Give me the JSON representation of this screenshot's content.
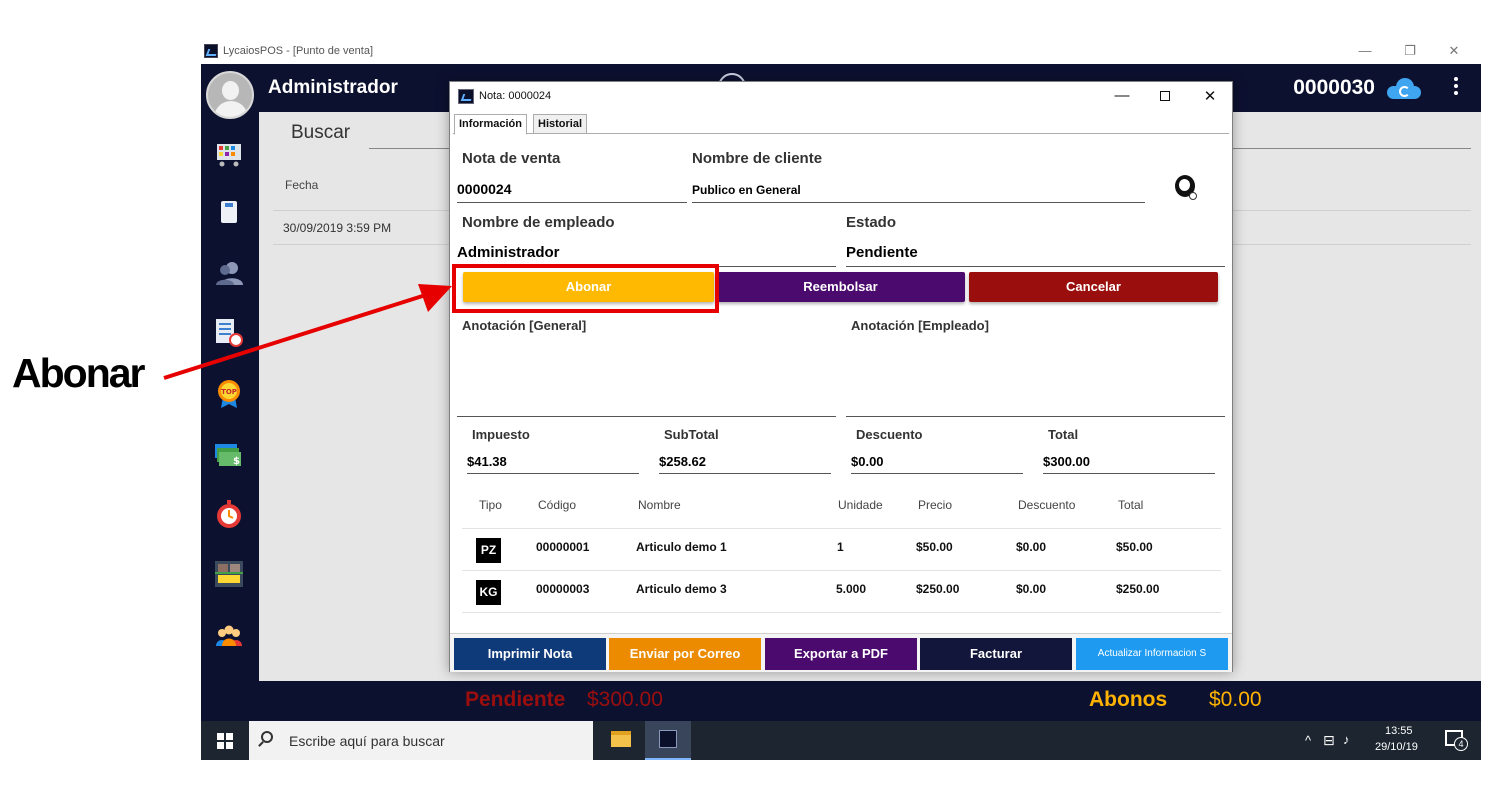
{
  "window": {
    "title": "LycaiosPOS - [Punto de venta]",
    "minimize": "—",
    "restore": "❐",
    "close": "✕"
  },
  "header": {
    "user_name": "Administrador",
    "count": "0000030"
  },
  "main": {
    "search_label": "Buscar",
    "column_fecha": "Fecha",
    "row_date": "30/09/2019 3:59 PM"
  },
  "bottom_bar": {
    "pending_label": "Pendiente",
    "pending_value": "$300.00",
    "abonos_label": "Abonos",
    "abonos_value": "$0.00"
  },
  "taskbar": {
    "search_placeholder": "Escribe aquí para buscar",
    "time": "13:55",
    "date": "29/10/19",
    "tray_chevron": "^",
    "notifications": "4"
  },
  "dialog": {
    "title": "Nota: 0000024",
    "minimize": "—",
    "close": "✕",
    "tabs": [
      {
        "label": "Información"
      },
      {
        "label": "Historial"
      }
    ],
    "nota_label": "Nota de venta",
    "nota_value": "0000024",
    "cliente_label": "Nombre de cliente",
    "cliente_value": "Publico en General",
    "empleado_label": "Nombre de empleado",
    "empleado_value": "Administrador",
    "estado_label": "Estado",
    "estado_value": "Pendiente",
    "buttons": {
      "abonar": "Abonar",
      "reembolsar": "Reembolsar",
      "cancelar": "Cancelar"
    },
    "anotacion_general": "Anotación [General]",
    "anotacion_empleado": "Anotación [Empleado]",
    "totals": {
      "impuesto_label": "Impuesto",
      "impuesto_value": "$41.38",
      "subtotal_label": "SubTotal",
      "subtotal_value": "$258.62",
      "descuento_label": "Descuento",
      "descuento_value": "$0.00",
      "total_label": "Total",
      "total_value": "$300.00"
    },
    "table": {
      "headers": [
        "Tipo",
        "Código",
        "Nombre",
        "Unidade",
        "Precio",
        "Descuento",
        "Total"
      ],
      "rows": [
        {
          "tipo": "PZ",
          "codigo": "00000001",
          "nombre": "Articulo demo 1",
          "unidades": "1",
          "precio": "$50.00",
          "descuento": "$0.00",
          "total": "$50.00"
        },
        {
          "tipo": "KG",
          "codigo": "00000003",
          "nombre": "Articulo demo 3",
          "unidades": "5.000",
          "precio": "$250.00",
          "descuento": "$0.00",
          "total": "$250.00"
        }
      ]
    },
    "footer": {
      "imprimir": "Imprimir Nota",
      "correo": "Enviar por Correo",
      "pdf": "Exportar a PDF",
      "facturar": "Facturar",
      "actualizar": "Actualizar Informacion S"
    }
  },
  "annotation": {
    "label": "Abonar"
  },
  "colors": {
    "app_dark": "#0d1130",
    "abonar": "#ffb900",
    "reembolsar": "#4b0a6e",
    "cancelar": "#9b0e0e",
    "imprimir": "#0e3a7a",
    "correo": "#ec8a00",
    "pdf": "#4b0a6e",
    "facturar": "#12163a",
    "actualizar": "#1e9bf0",
    "highlight": "#e60000"
  }
}
